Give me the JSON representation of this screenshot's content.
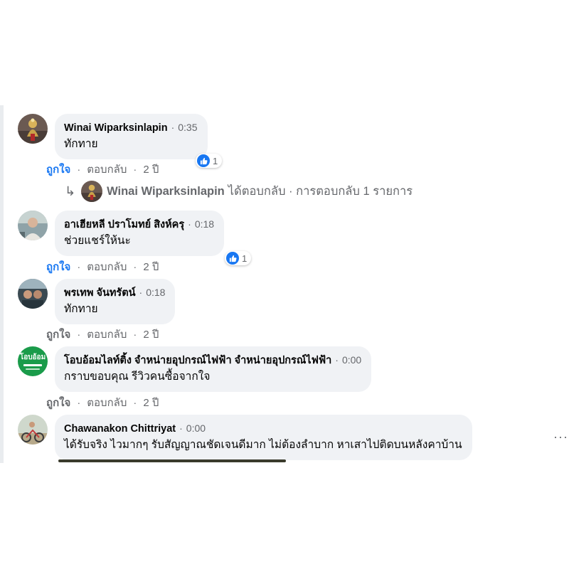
{
  "comments": [
    {
      "author": "Winai Wiparksinlapin",
      "time": "0:35",
      "text": "ทักทาย",
      "like_label": "ถูกใจ",
      "reply_label": "ตอบกลับ",
      "age": "2 ปี",
      "reaction_count": "1",
      "liked": true,
      "avatar": "buddha-statue-avatar"
    },
    {
      "author": "อาเฮียหลี ปราโมทย์ สิงห์ครุ",
      "time": "0:18",
      "text": "ช่วยแชร์ให้นะ",
      "like_label": "ถูกใจ",
      "reply_label": "ตอบกลับ",
      "age": "2 ปี",
      "reaction_count": "1",
      "liked": true,
      "avatar": "person-photo-avatar"
    },
    {
      "author": "พรเทพ จันทรัตน์",
      "time": "0:18",
      "text": "ทักทาย",
      "like_label": "ถูกใจ",
      "reply_label": "ตอบกลับ",
      "age": "2 ปี",
      "liked": false,
      "avatar": "car-selfie-avatar"
    },
    {
      "author": "โอบอ้อมไลท์ติ้ง จำหน่ายอุปกรณ์ไฟฟ้า จำหน่ายอุปกรณ์ไฟฟ้า",
      "time": "0:00",
      "text": "กราบขอบคุณ รีวิวคนซื้อจากใจ",
      "like_label": "ถูกใจ",
      "reply_label": "ตอบกลับ",
      "age": "2 ปี",
      "liked": false,
      "avatar": "obom-logo-avatar",
      "avatar_text": "โอบอ้อม"
    },
    {
      "author": "Chawanakon Chittriyat",
      "time": "0:00",
      "text": "ได้รับจริง ไวมากๆ รับสัญญาณชัดเจนดีมาก ไม่ต้องลำบาก หาเสาไปติดบนหลังคาบ้าน",
      "avatar": "bicycle-kid-avatar"
    }
  ],
  "reply_thread": {
    "author": "Winai Wiparksinlapin",
    "text": "ได้ตอบกลับ · การตอบกลับ 1 รายการ"
  },
  "separator": "·",
  "more_options": "···",
  "colors": {
    "bubble": "#f0f2f5",
    "like_blue": "#1877f2",
    "secondary_text": "#65676b",
    "obom_green": "#1a9b4a"
  }
}
